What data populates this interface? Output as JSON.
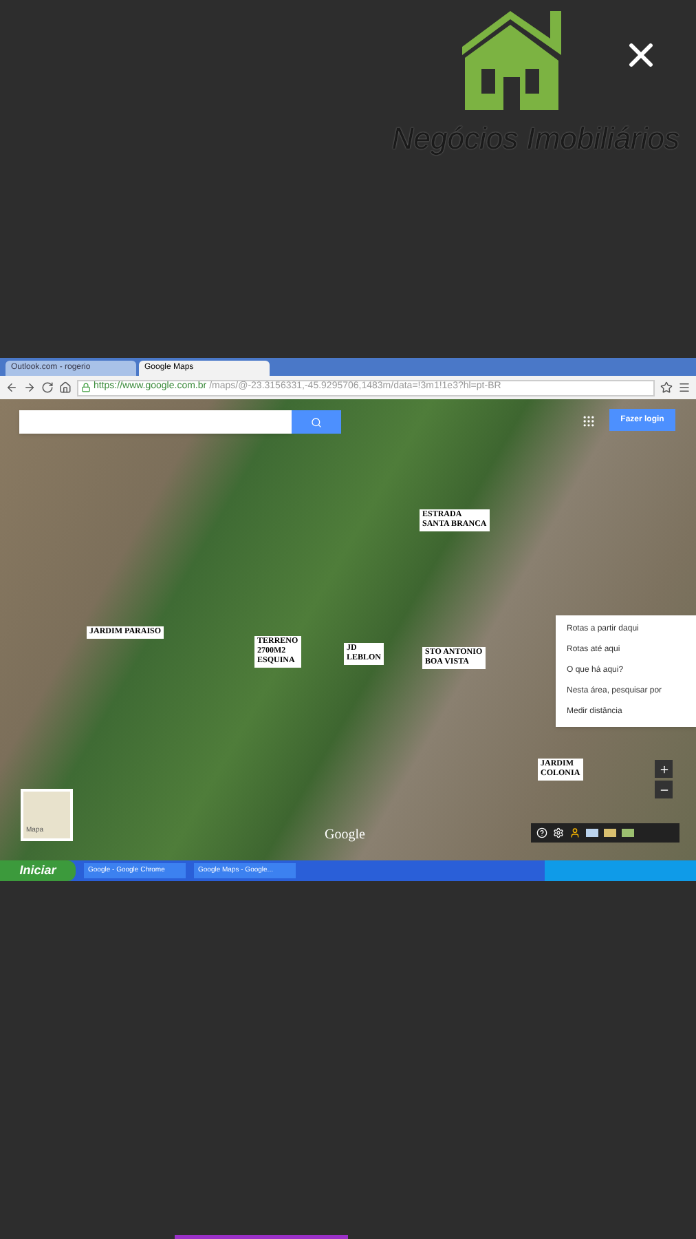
{
  "brand": {
    "name": "Negócios Imobiliários"
  },
  "browser": {
    "tabs": [
      {
        "label": "Outlook.com - rogerio",
        "selected": false
      },
      {
        "label": "Google Maps",
        "selected": true
      }
    ],
    "url": {
      "secure": "https://www.google.com.br",
      "path": "/maps/@-23.3156331,-45.9295706,1483m/data=!3m1!1e3?hl=pt-BR"
    }
  },
  "map": {
    "login_button": "Fazer login",
    "watermark": "Google",
    "thumbnail_label": "Mapa",
    "labels": [
      {
        "lines": [
          "ESTRADA",
          "SANTA BRANCA"
        ]
      },
      {
        "lines": [
          "JARDIM PARAISO"
        ]
      },
      {
        "lines": [
          "TERRENO",
          "2700M2",
          "ESQUINA"
        ]
      },
      {
        "lines": [
          "JD",
          "LEBLON"
        ]
      },
      {
        "lines": [
          "STO ANTONIO",
          "BOA VISTA"
        ]
      },
      {
        "lines": [
          "JARDIM",
          "COLONIA"
        ]
      }
    ],
    "context_menu": [
      "Rotas a partir daqui",
      "Rotas até aqui",
      "O que há aqui?",
      "Nesta área, pesquisar por",
      "Medir distância"
    ]
  },
  "taskbar": {
    "start": "Iniciar",
    "items": [
      "Google - Google Chrome",
      "Google Maps - Google..."
    ]
  }
}
